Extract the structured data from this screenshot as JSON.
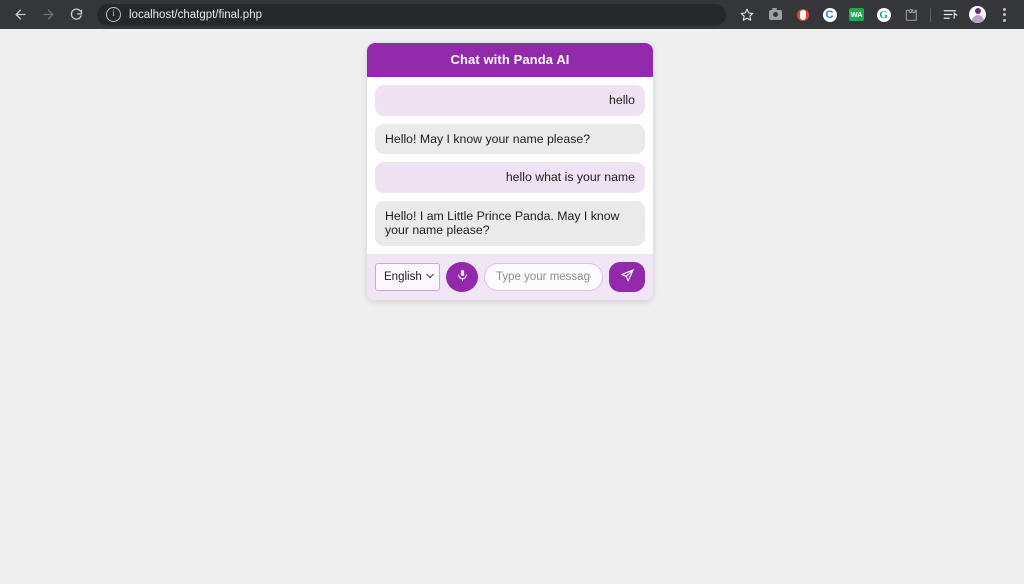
{
  "browser": {
    "back_label": "back-arrow",
    "forward_label": "forward-arrow",
    "reload_label": "reload",
    "site_info_glyph": "i",
    "url": "localhost/chatgpt/final.php",
    "toolbar_icons": [
      {
        "name": "screenshot-extension-icon",
        "label": "camera"
      },
      {
        "name": "recorder-extension-icon",
        "label": "droplet"
      },
      {
        "name": "c-extension-icon",
        "label": "C"
      },
      {
        "name": "wa-extension-icon",
        "label": "WA"
      },
      {
        "name": "grammarly-extension-icon",
        "label": "G"
      },
      {
        "name": "extensions-puzzle-icon",
        "label": "puzzle"
      },
      {
        "name": "reading-list-icon",
        "label": "list"
      },
      {
        "name": "profile-avatar-icon",
        "label": "avatar"
      },
      {
        "name": "chrome-menu-icon",
        "label": "kebab"
      }
    ]
  },
  "chat": {
    "header_title": "Chat with Panda AI",
    "messages": [
      {
        "sender": "user",
        "text": "hello"
      },
      {
        "sender": "bot",
        "text": "Hello! May I know your name please?"
      },
      {
        "sender": "user",
        "text": "hello what is your name"
      },
      {
        "sender": "bot",
        "text": "Hello! I am Little Prince Panda. May I know your name please?"
      }
    ],
    "input_bar": {
      "language_selected": "English",
      "language_options": [
        "English"
      ],
      "chevron_glyph": "⌄",
      "mic_label": "microphone",
      "message_value": "",
      "message_placeholder": "Type your message or speak...",
      "send_label": "send"
    }
  },
  "colors": {
    "brand_purple": "#9229AB",
    "user_bubble": "#EFE3F3",
    "bot_bubble": "#EAEAEA",
    "input_bar_bg": "#F1E6F5",
    "page_bg": "#EFEFEF"
  }
}
